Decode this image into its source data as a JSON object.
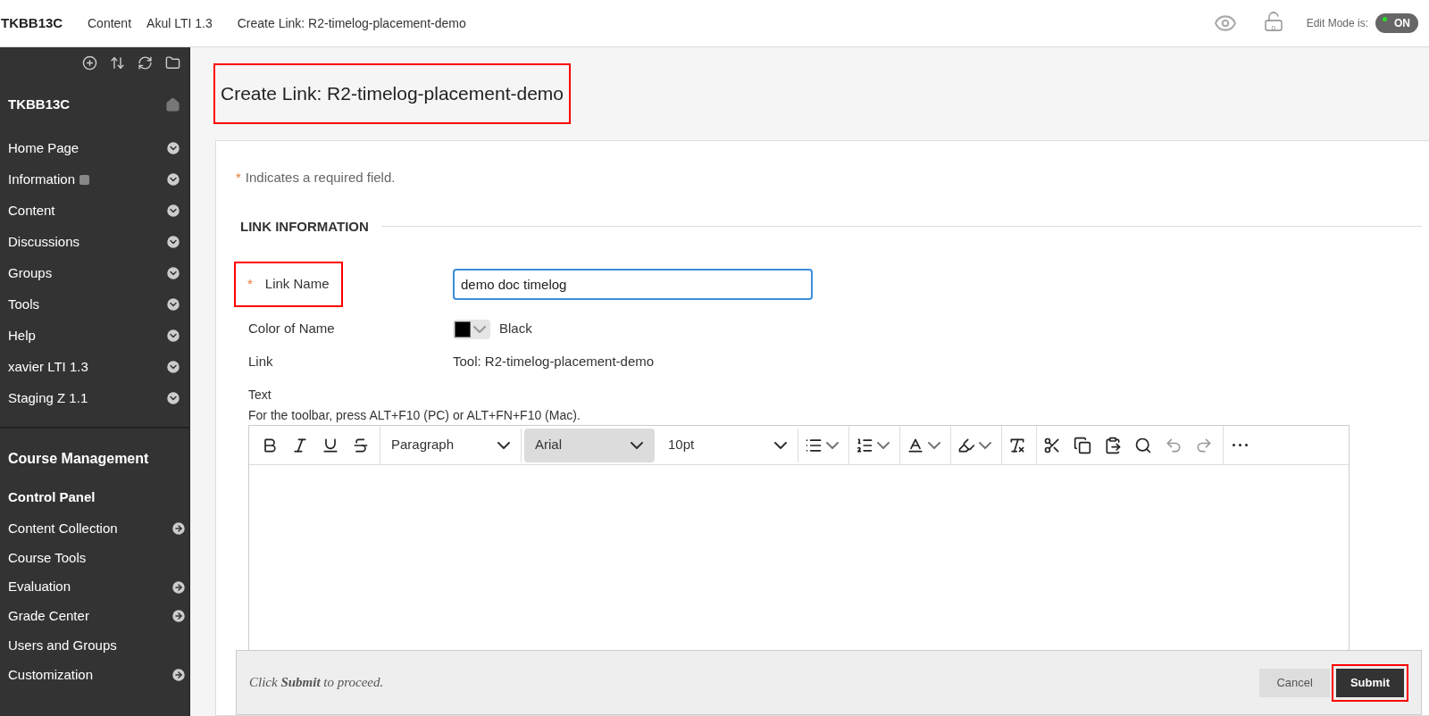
{
  "topbar": {
    "course": "TKBB13C",
    "breadcrumbs": [
      "Content",
      "Akul LTI 1.3",
      "Create Link: R2-timelog-placement-demo"
    ],
    "lock_count": "0",
    "edit_mode_label": "Edit Mode is:",
    "edit_mode": {
      "on": true,
      "label": "ON"
    }
  },
  "sidebar": {
    "course": "TKBB13C",
    "items": [
      {
        "label": "Home Page",
        "kind": "expand",
        "flagged": false
      },
      {
        "label": "Information",
        "kind": "expand",
        "flagged": true
      },
      {
        "label": "Content",
        "kind": "expand",
        "flagged": false
      },
      {
        "label": "Discussions",
        "kind": "expand",
        "flagged": false
      },
      {
        "label": "Groups",
        "kind": "expand",
        "flagged": false
      },
      {
        "label": "Tools",
        "kind": "expand",
        "flagged": false
      },
      {
        "label": "Help",
        "kind": "expand",
        "flagged": false
      },
      {
        "label": "xavier LTI 1.3",
        "kind": "expand",
        "flagged": false
      },
      {
        "label": "Staging Z 1.1",
        "kind": "expand",
        "flagged": false
      }
    ],
    "management_title": "Course Management",
    "panel_title": "Control Panel",
    "panel_items": [
      {
        "label": "Content Collection",
        "kind": "go"
      },
      {
        "label": "Course Tools",
        "kind": "none"
      },
      {
        "label": "Evaluation",
        "kind": "go"
      },
      {
        "label": "Grade Center",
        "kind": "go"
      },
      {
        "label": "Users and Groups",
        "kind": "none"
      },
      {
        "label": "Customization",
        "kind": "go"
      }
    ]
  },
  "title": {
    "text": "Create Link: R2-timelog-placement-demo",
    "highlighted": true
  },
  "required_note": {
    "mark": "*",
    "text": "Indicates a required field."
  },
  "section_title": "LINK INFORMATION",
  "link_name": {
    "mark": "*",
    "label": "Link Name",
    "value": "demo doc timelog",
    "highlighted": true
  },
  "color_of_name": {
    "label": "Color of Name",
    "color": "#000000",
    "value": "Black"
  },
  "link": {
    "label": "Link",
    "value": "Tool: R2-timelog-placement-demo"
  },
  "text_field": {
    "label": "Text",
    "hint": "For the toolbar, press ALT+F10 (PC) or ALT+FN+F10 (Mac)."
  },
  "toolbar": [
    {
      "kind": "bold"
    },
    {
      "kind": "italic"
    },
    {
      "kind": "underline"
    },
    {
      "kind": "strike"
    },
    {
      "kind": "select",
      "label": "Paragraph",
      "selected": false
    },
    {
      "kind": "select",
      "label": "Arial",
      "selected": true
    },
    {
      "kind": "select",
      "label": "10pt",
      "selected": false
    },
    {
      "kind": "bullets"
    },
    {
      "kind": "numbers"
    },
    {
      "kind": "textcolor"
    },
    {
      "kind": "highlight"
    },
    {
      "kind": "clear"
    },
    {
      "kind": "cut"
    },
    {
      "kind": "copy"
    },
    {
      "kind": "paste"
    },
    {
      "kind": "find"
    },
    {
      "kind": "undo"
    },
    {
      "kind": "redo"
    },
    {
      "kind": "more"
    }
  ],
  "footer": {
    "hint": "Click **Submit** to proceed.",
    "cancel": "Cancel",
    "submit": {
      "label": "Submit",
      "highlighted": true
    }
  }
}
